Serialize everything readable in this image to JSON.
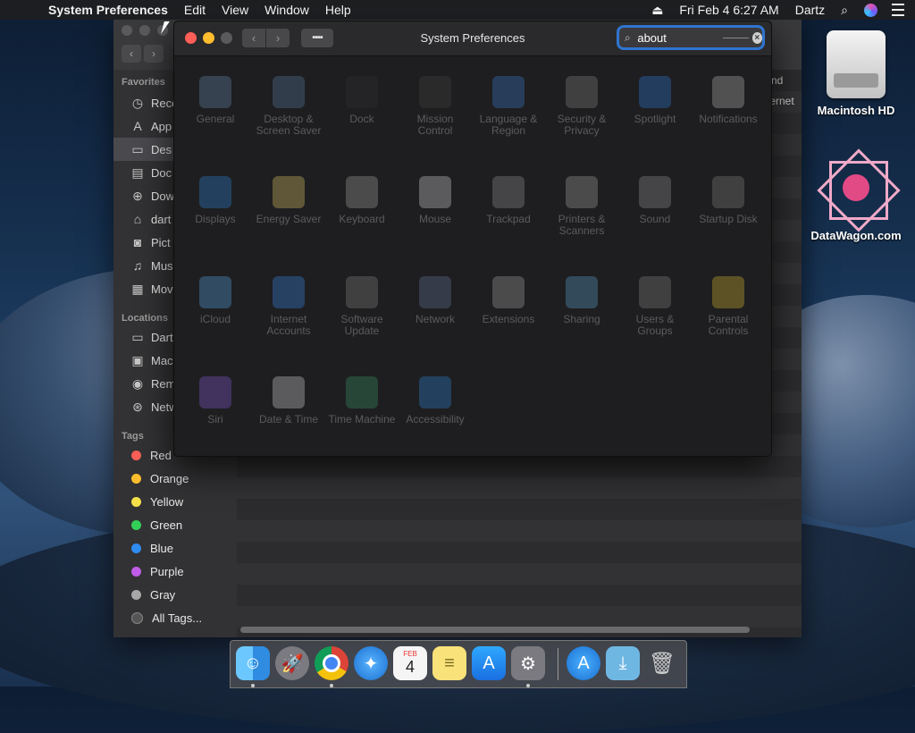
{
  "menubar": {
    "app_name": "System Preferences",
    "items": [
      "Edit",
      "View",
      "Window",
      "Help"
    ],
    "date_time": "Fri Feb 4  6:27 AM",
    "user": "Dartz"
  },
  "finder": {
    "sidebar": {
      "favorites_header": "Favorites",
      "favorites": [
        "Rece",
        "App",
        "Des",
        "Doc",
        "Dow",
        "dart",
        "Pict",
        "Mus",
        "Mov"
      ],
      "locations_header": "Locations",
      "locations": [
        "Dart",
        "Mac",
        "Rem",
        "Netw"
      ],
      "tags_header": "Tags",
      "tags": [
        {
          "label": "Red",
          "color": "#ff5f57"
        },
        {
          "label": "Orange",
          "color": "#febc2e"
        },
        {
          "label": "Yellow",
          "color": "#f5e04a"
        },
        {
          "label": "Green",
          "color": "#33d058"
        },
        {
          "label": "Blue",
          "color": "#2f8cf0"
        },
        {
          "label": "Purple",
          "color": "#c15ce8"
        },
        {
          "label": "Gray",
          "color": "#a8a8a8"
        },
        {
          "label": "All Tags...",
          "color": "#555555"
        }
      ]
    },
    "peek_text": [
      "nd",
      "ternet"
    ]
  },
  "sysprefs": {
    "title": "System Preferences",
    "search_value": "about",
    "panes": [
      {
        "label": "General",
        "icon": "general-icon",
        "color": "#6c8fb5"
      },
      {
        "label": "Desktop & Screen Saver",
        "icon": "desktop-icon",
        "color": "#5d7ea8"
      },
      {
        "label": "Dock",
        "icon": "dock-icon",
        "color": "#333333"
      },
      {
        "label": "Mission Control",
        "icon": "mission-control-icon",
        "color": "#444444"
      },
      {
        "label": "Language & Region",
        "icon": "globe-icon",
        "color": "#3f7fd0"
      },
      {
        "label": "Security & Privacy",
        "icon": "house-icon",
        "color": "#888888"
      },
      {
        "label": "Spotlight",
        "icon": "spotlight-icon",
        "color": "#2f7fe0"
      },
      {
        "label": "Notifications",
        "icon": "notifications-icon",
        "color": "#bdbdbd"
      },
      {
        "label": "Displays",
        "icon": "display-icon",
        "color": "#2f8ce0"
      },
      {
        "label": "Energy Saver",
        "icon": "lightbulb-icon",
        "color": "#e8d06a"
      },
      {
        "label": "Keyboard",
        "icon": "keyboard-icon",
        "color": "#aaaaaa"
      },
      {
        "label": "Mouse",
        "icon": "mouse-icon",
        "color": "#dddddd"
      },
      {
        "label": "Trackpad",
        "icon": "trackpad-icon",
        "color": "#999999"
      },
      {
        "label": "Printers & Scanners",
        "icon": "printer-icon",
        "color": "#aaaaaa"
      },
      {
        "label": "Sound",
        "icon": "speaker-icon",
        "color": "#999999"
      },
      {
        "label": "Startup Disk",
        "icon": "disk-icon",
        "color": "#888888"
      },
      {
        "label": "iCloud",
        "icon": "cloud-icon",
        "color": "#5aa9f0"
      },
      {
        "label": "Internet Accounts",
        "icon": "at-sign-icon",
        "color": "#3a8df0"
      },
      {
        "label": "Software Update",
        "icon": "gear-icon",
        "color": "#888888"
      },
      {
        "label": "Network",
        "icon": "network-icon",
        "color": "#6a7aa0"
      },
      {
        "label": "Extensions",
        "icon": "puzzle-icon",
        "color": "#aaaaaa"
      },
      {
        "label": "Sharing",
        "icon": "sharing-folder-icon",
        "color": "#5fa8d8"
      },
      {
        "label": "Users & Groups",
        "icon": "users-icon",
        "color": "#888888"
      },
      {
        "label": "Parental Controls",
        "icon": "parental-controls-icon",
        "color": "#e0c030"
      },
      {
        "label": "Siri",
        "icon": "siri-icon",
        "color": "#8a5ce0"
      },
      {
        "label": "Date & Time",
        "icon": "clock-icon",
        "color": "#dddddd"
      },
      {
        "label": "Time Machine",
        "icon": "time-machine-icon",
        "color": "#3a9a6a"
      },
      {
        "label": "Accessibility",
        "icon": "accessibility-icon",
        "color": "#2f8ce0"
      }
    ]
  },
  "desktop": {
    "icons": [
      "Macintosh HD",
      "DataWagon.com"
    ]
  },
  "dock": {
    "calendar_month": "FEB",
    "calendar_day": "4"
  }
}
